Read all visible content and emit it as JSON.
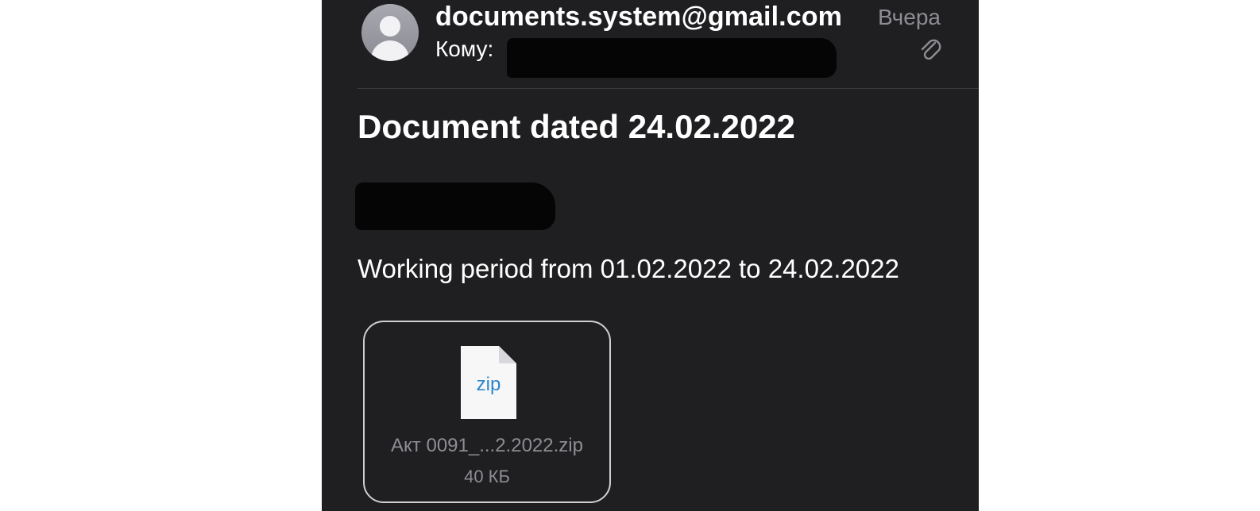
{
  "email": {
    "sender": "documents.system@gmail.com",
    "date": "Вчера",
    "to_label": "Кому:",
    "subject": "Document dated 24.02.2022",
    "body": "Working period from 01.02.2022 to 24.02.2022"
  },
  "attachment": {
    "type_label": "zip",
    "file_name": "Акт 0091_...2.2022.zip",
    "file_size": "40 КБ"
  },
  "icons": {
    "avatar": "person-avatar-icon",
    "attachment_indicator": "paperclip-icon",
    "file": "zip-file-icon"
  },
  "colors": {
    "background": "#1f1f21",
    "text_primary": "#ffffff",
    "text_secondary": "#8d8d93",
    "zip_label": "#2d86c9"
  }
}
